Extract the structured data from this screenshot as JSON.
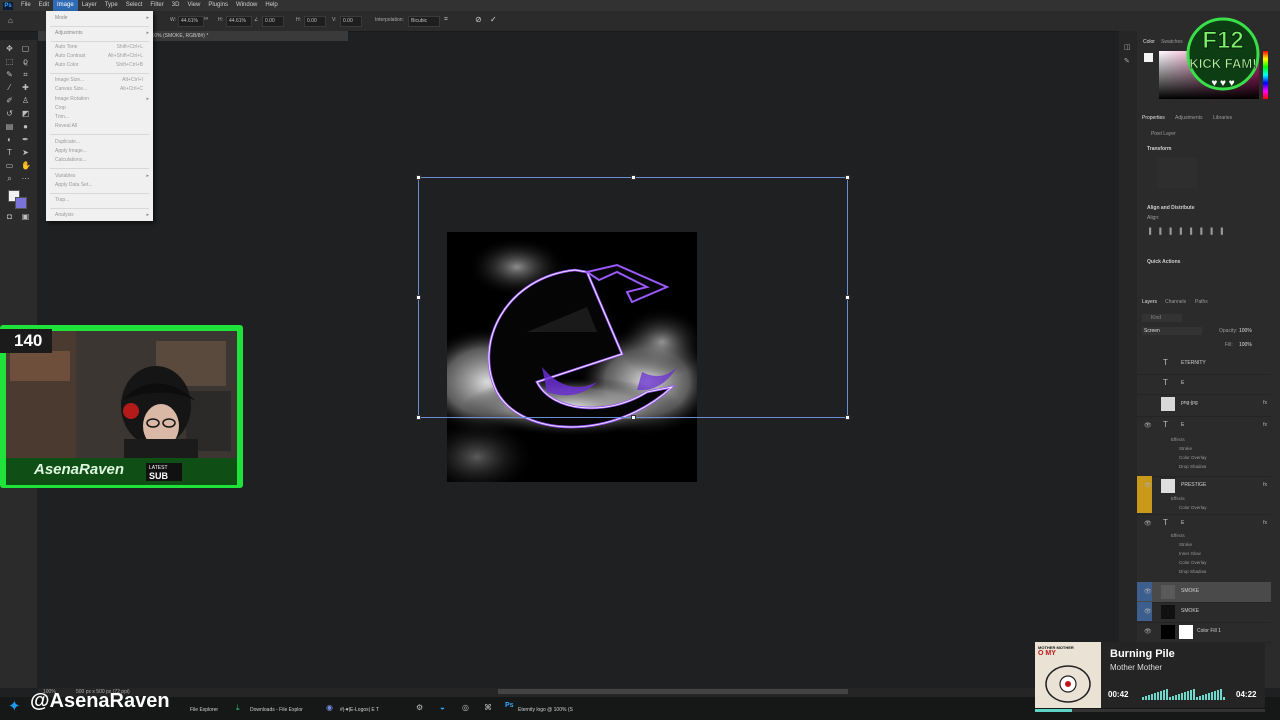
{
  "menubar": {
    "items": [
      "File",
      "Edit",
      "Image",
      "Layer",
      "Type",
      "Select",
      "Filter",
      "3D",
      "View",
      "Plugins",
      "Window",
      "Help"
    ],
    "active": "Image"
  },
  "options_bar": {
    "w_value": "44.61%",
    "h_value": "44.61%",
    "angle_value": "0.00",
    "h_skew": "0.00",
    "v_skew": "0.00",
    "interpolation_label": "Interpolation:",
    "interpolation_value": "Bicubic"
  },
  "document_tab": "Euphoria Pack - Pumpkin x Dynay.psd @ 100% (SMOKE, RGB/8#) *",
  "image_menu": {
    "groups": [
      [
        {
          "label": "Mode",
          "arrow": true
        }
      ],
      [
        {
          "label": "Adjustments",
          "arrow": true
        }
      ],
      [
        {
          "label": "Auto Tone",
          "shortcut": "Shift+Ctrl+L"
        },
        {
          "label": "Auto Contrast",
          "shortcut": "Alt+Shift+Ctrl+L"
        },
        {
          "label": "Auto Color",
          "shortcut": "Shift+Ctrl+B"
        }
      ],
      [
        {
          "label": "Image Size...",
          "shortcut": "Alt+Ctrl+I"
        },
        {
          "label": "Canvas Size...",
          "shortcut": "Alt+Ctrl+C"
        },
        {
          "label": "Image Rotation",
          "arrow": true
        },
        {
          "label": "Crop"
        },
        {
          "label": "Trim..."
        },
        {
          "label": "Reveal All"
        }
      ],
      [
        {
          "label": "Duplicate..."
        },
        {
          "label": "Apply Image..."
        },
        {
          "label": "Calculations..."
        }
      ],
      [
        {
          "label": "Variables",
          "arrow": true
        },
        {
          "label": "Apply Data Set..."
        }
      ],
      [
        {
          "label": "Trap..."
        }
      ],
      [
        {
          "label": "Analysis",
          "arrow": true
        }
      ]
    ]
  },
  "panels": {
    "color_tabs": [
      "Color",
      "Swatches"
    ],
    "properties_tabs": [
      "Properties",
      "Adjustments",
      "Libraries"
    ],
    "properties_kind": "Pixel Layer",
    "transform_label": "Transform",
    "align_label": "Align and Distribute",
    "align_sub": "Align:",
    "quick_actions": "Quick Actions",
    "layers_tabs": [
      "Layers",
      "Channels",
      "Paths"
    ],
    "blend_mode": "Screen",
    "opacity_label": "Opacity:",
    "opacity_value": "100%",
    "fill_label": "Fill:",
    "fill_value": "100%",
    "search_placeholder": "Kind"
  },
  "layers": [
    {
      "name": "ETERNITY",
      "kind": "text",
      "visible": false
    },
    {
      "name": "E",
      "kind": "text",
      "visible": false
    },
    {
      "name": "png-jpg",
      "kind": "image",
      "visible": false,
      "fx": true
    },
    {
      "name": "E",
      "kind": "text",
      "visible": true,
      "fx": true,
      "effects": [
        "Effects",
        "Stroke",
        "Color Overlay",
        "Drop Shadow"
      ]
    },
    {
      "name": "PRESTIGE",
      "kind": "image",
      "visible": true,
      "fx": true,
      "highlight": "#c99a1a",
      "effects": [
        "Effects",
        "Color Overlay"
      ]
    },
    {
      "name": "E",
      "kind": "text",
      "visible": true,
      "fx": true,
      "effects": [
        "Effects",
        "Stroke",
        "Inner Glow",
        "Color Overlay",
        "Drop Shadow"
      ]
    },
    {
      "name": "SMOKE",
      "kind": "image",
      "visible": true,
      "selected": true
    },
    {
      "name": "SMOKE",
      "kind": "image",
      "visible": true
    },
    {
      "name": "Color Fill 1",
      "kind": "fill",
      "visible": true
    }
  ],
  "stream": {
    "viewer_count": "140",
    "streamer_name": "AsenaRaven",
    "latest_sub_line1": "LATEST",
    "latest_sub_line2": "SUB",
    "handle": "@AsenaRaven",
    "badge_line1": "F12",
    "badge_line2": "KICK FAM!"
  },
  "now_playing": {
    "title": "Burning Pile",
    "artist": "Mother Mother",
    "album_text": "MOTHER MOTHER",
    "album_text2": "O MY",
    "elapsed": "00:42",
    "total": "04:22",
    "progress": 0.16
  },
  "statusbar": {
    "zoom": "100%",
    "doc_info": "500 px x 500 px (72 ppi)"
  },
  "taskbar": {
    "items": [
      "File Explorer",
      "Downloads - File Explor",
      "#|-♥|E-Logos| E T",
      "Eternity logo @ 100% (S"
    ]
  },
  "colors": {
    "accent_green": "#1fe23b",
    "ps_blue": "#31a8ff",
    "menu_active": "#2f6bb5",
    "logo_purple": "#8a3cff"
  }
}
